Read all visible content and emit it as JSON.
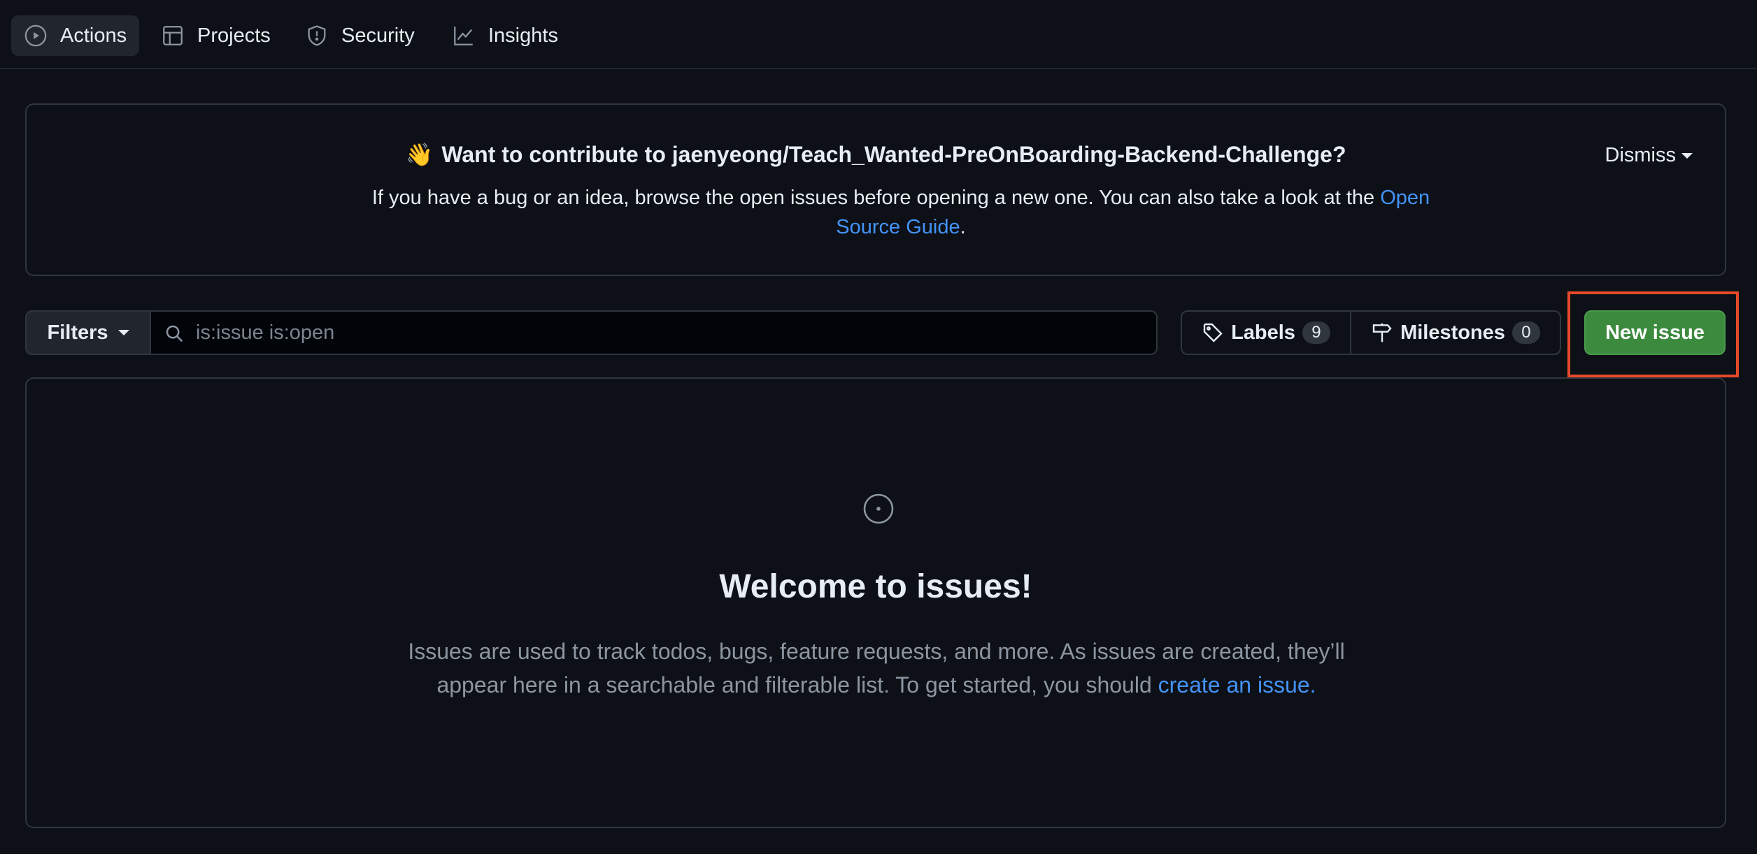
{
  "nav": {
    "items": [
      {
        "label": "Actions",
        "icon": "play-circle-icon",
        "active": true
      },
      {
        "label": "Projects",
        "icon": "table-icon",
        "active": false
      },
      {
        "label": "Security",
        "icon": "shield-icon",
        "active": false
      },
      {
        "label": "Insights",
        "icon": "graph-icon",
        "active": false
      }
    ]
  },
  "banner": {
    "emoji": "👋",
    "title": "Want to contribute to jaenyeong/Teach_Wanted-PreOnBoarding-Backend-Challenge?",
    "text_before": "If you have a bug or an idea, browse the open issues before opening a new one. You can also take a look at the ",
    "link_text": "Open Source Guide",
    "text_after": ".",
    "dismiss_label": "Dismiss"
  },
  "toolbar": {
    "filters_label": "Filters",
    "search_value": "is:issue is:open",
    "labels_label": "Labels",
    "labels_count": "9",
    "milestones_label": "Milestones",
    "milestones_count": "0",
    "new_issue_label": "New issue"
  },
  "empty_state": {
    "title": "Welcome to issues!",
    "text_before": "Issues are used to track todos, bugs, feature requests, and more. As issues are created, they’ll appear here in a searchable and filterable list. To get started, you should ",
    "link_text": "create an issue",
    "text_after": "."
  },
  "colors": {
    "background": "#0d1117",
    "border": "#30363d",
    "link": "#4493f8",
    "primary_button": "#3c8a3e",
    "highlight": "#e5492a"
  }
}
